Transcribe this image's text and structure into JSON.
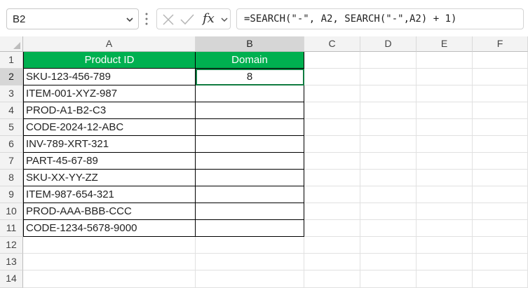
{
  "namebox": {
    "value": "B2"
  },
  "formula_bar": {
    "fx": "fx",
    "formula": "=SEARCH(\"-\", A2, SEARCH(\"-\",A2) + 1)"
  },
  "columns": [
    "A",
    "B",
    "C",
    "D",
    "E",
    "F"
  ],
  "rows": [
    "1",
    "2",
    "3",
    "4",
    "5",
    "6",
    "7",
    "8",
    "9",
    "10",
    "11",
    "12",
    "13",
    "14"
  ],
  "table": {
    "headers": {
      "a": "Product ID",
      "b": "Domain"
    },
    "ids": [
      "SKU-123-456-789",
      "ITEM-001-XYZ-987",
      "PROD-A1-B2-C3",
      "CODE-2024-12-ABC",
      "INV-789-XRT-321",
      "PART-45-67-89",
      "SKU-XX-YY-ZZ",
      "ITEM-987-654-321",
      "PROD-AAA-BBB-CCC",
      "CODE-1234-5678-9000"
    ],
    "domain": [
      "8",
      "",
      "",
      "",
      "",
      "",
      "",
      "",
      "",
      ""
    ]
  },
  "colors": {
    "header_fill": "#00b050",
    "header_text": "#ffffff",
    "selection": "#107c41"
  }
}
